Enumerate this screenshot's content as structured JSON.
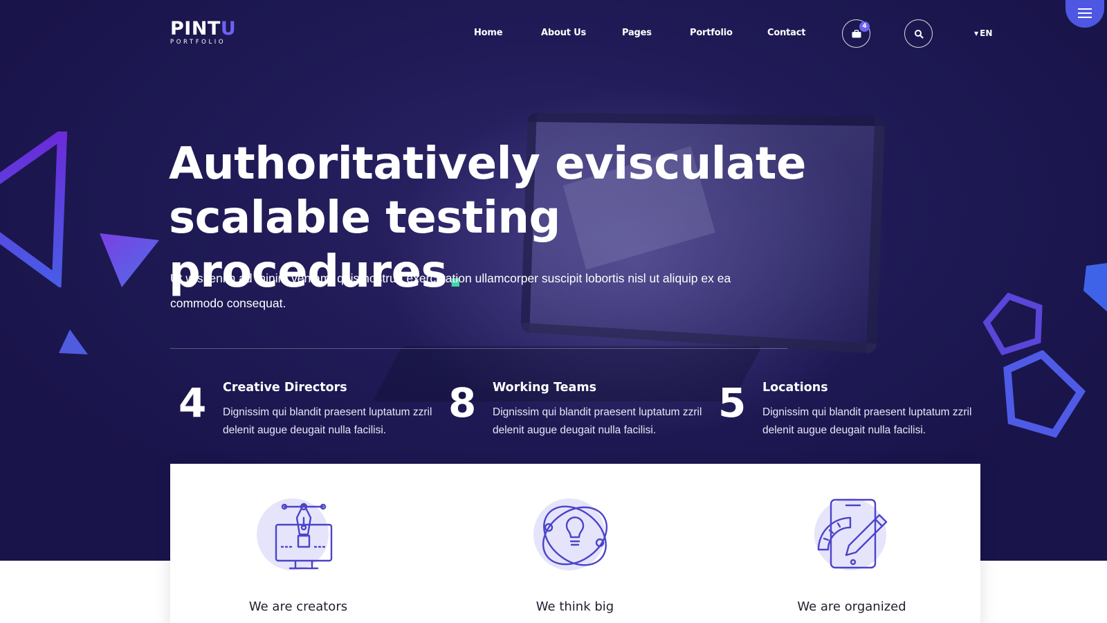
{
  "brand": {
    "name_main": "PINT",
    "name_accent": "U",
    "tagline": "PORTFOLIO"
  },
  "nav": {
    "items": [
      "Home",
      "About Us",
      "Pages",
      "Portfolio",
      "Contact"
    ],
    "cart_count": "4",
    "language": "EN"
  },
  "hero": {
    "headline_line1": "Authoritatively evisculate",
    "headline_line2": "scalable testing procedures",
    "headline_dot": ".",
    "lead": "Ut wisi enim ad minim veniam, quis nostrud exerci tation ullamcorper suscipit lobortis nisl ut aliquip ex ea commodo consequat."
  },
  "stats": [
    {
      "number": "4",
      "title": "Creative Directors",
      "description": "Dignissim qui blandit praesent luptatum zzril delenit augue deugait nulla facilisi."
    },
    {
      "number": "8",
      "title": "Working Teams",
      "description": "Dignissim qui blandit praesent luptatum zzril delenit augue deugait nulla facilisi."
    },
    {
      "number": "5",
      "title": "Locations",
      "description": "Dignissim qui blandit praesent luptatum zzril delenit augue deugait nulla facilisi."
    }
  ],
  "features": [
    {
      "label": "We are creators",
      "icon": "pen-tool-monitor-icon"
    },
    {
      "label": "We think big",
      "icon": "lightbulb-orbit-icon"
    },
    {
      "label": "We are organized",
      "icon": "tablet-pencil-icon"
    }
  ],
  "colors": {
    "accent": "#6d62f1",
    "dot": "#3fd6a6",
    "hero_bg": "#1f1a55",
    "burger": "#4d57e2"
  }
}
